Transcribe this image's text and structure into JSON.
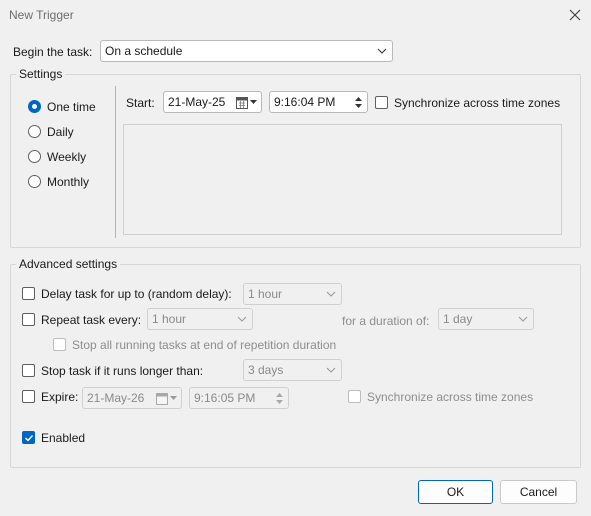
{
  "window": {
    "title": "New Trigger"
  },
  "begin": {
    "label": "Begin the task:",
    "value": "On a schedule"
  },
  "settings": {
    "title": "Settings",
    "schedule_options": [
      {
        "label": "One time",
        "selected": true
      },
      {
        "label": "Daily",
        "selected": false
      },
      {
        "label": "Weekly",
        "selected": false
      },
      {
        "label": "Monthly",
        "selected": false
      }
    ],
    "start_label": "Start:",
    "start_date": "21-May-25",
    "start_time": "9:16:04 PM",
    "sync_label": "Synchronize across time zones",
    "sync_checked": false
  },
  "advanced": {
    "title": "Advanced settings",
    "delay": {
      "label": "Delay task for up to (random delay):",
      "value": "1 hour",
      "checked": false
    },
    "repeat": {
      "label": "Repeat task every:",
      "value": "1 hour",
      "checked": false,
      "duration_label": "for a duration of:",
      "duration_value": "1 day"
    },
    "stop_running": {
      "label": "Stop all running tasks at end of repetition duration",
      "checked": false
    },
    "stop_longer": {
      "label": "Stop task if it runs longer than:",
      "value": "3 days",
      "checked": false
    },
    "expire": {
      "label": "Expire:",
      "date": "21-May-26",
      "time": "9:16:05 PM",
      "checked": false,
      "sync_label": "Synchronize across time zones"
    },
    "enabled": {
      "label": "Enabled",
      "checked": true
    }
  },
  "buttons": {
    "ok": "OK",
    "cancel": "Cancel"
  },
  "colors": {
    "accent": "#0067c0",
    "background": "#f0f0f0"
  },
  "icons": {
    "close": "close-icon",
    "calendar": "calendar-icon",
    "dropdown": "chevron-down-icon",
    "spinner": "spinner-arrows-icon"
  }
}
